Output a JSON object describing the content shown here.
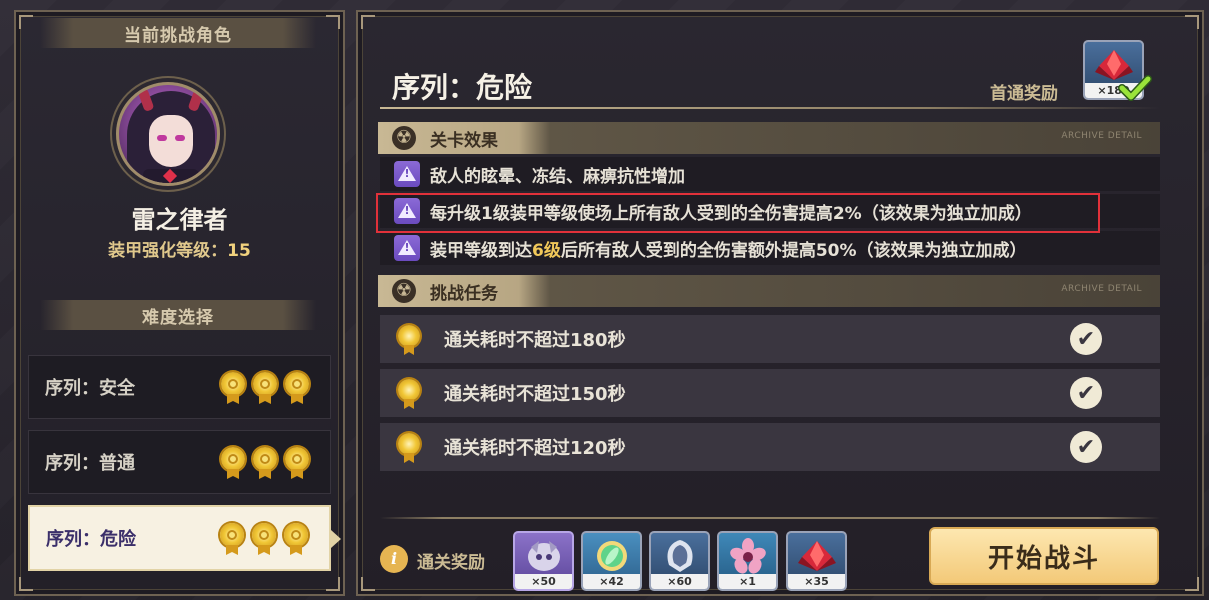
{
  "left": {
    "current_header": "当前挑战角色",
    "character_name": "雷之律者",
    "armor_level_label": "装甲强化等级：",
    "armor_level_value": "15",
    "difficulty_header": "难度选择",
    "difficulties": [
      {
        "label": "序列：安全",
        "medals": 3
      },
      {
        "label": "序列：普通",
        "medals": 3
      },
      {
        "label": "序列：危险",
        "medals": 3,
        "selected": true
      }
    ]
  },
  "right": {
    "title": "序列：危险",
    "first_clear_label": "首通奖励",
    "first_clear_reward": {
      "icon": "red-crystal-icon",
      "qty": "×180",
      "claimed": true
    },
    "effects_header": "关卡效果",
    "effects_archive": "ARCHIVE DETAIL",
    "effects": [
      {
        "pre": "敌人的眩晕、冻结、麻痹抗性增加",
        "hl": "",
        "post": ""
      },
      {
        "pre": "每升级1级装甲等级使场上所有敌人受到的全伤害提高2%（该效果为独立加成）",
        "hl": "",
        "post": ""
      },
      {
        "pre": "装甲等级到达",
        "hl": "6级",
        "post": "后所有敌人受到的全伤害额外提高50%（该效果为独立加成）"
      }
    ],
    "missions_header": "挑战任务",
    "missions_archive": "ARCHIVE DETAIL",
    "missions": [
      {
        "text": "通关耗时不超过180秒",
        "done": true
      },
      {
        "text": "通关耗时不超过150秒",
        "done": true
      },
      {
        "text": "通关耗时不超过120秒",
        "done": true
      }
    ],
    "clear_reward_label": "通关奖励",
    "clear_rewards": [
      {
        "icon": "beast-stigma-icon",
        "qty": "×50"
      },
      {
        "icon": "green-core-icon",
        "qty": "×42"
      },
      {
        "icon": "armor-shard-icon",
        "qty": "×60"
      },
      {
        "icon": "sakura-emblem-icon",
        "qty": "×1"
      },
      {
        "icon": "red-crystal-icon",
        "qty": "×35"
      }
    ],
    "start_button": "开始战斗",
    "check_glyph": "✔"
  },
  "colors": {
    "accent_gold": "#f1c85a",
    "highlight_red": "#e1313a",
    "button_bg": "#f3c978",
    "warn_purple": "#6b4bbf"
  }
}
